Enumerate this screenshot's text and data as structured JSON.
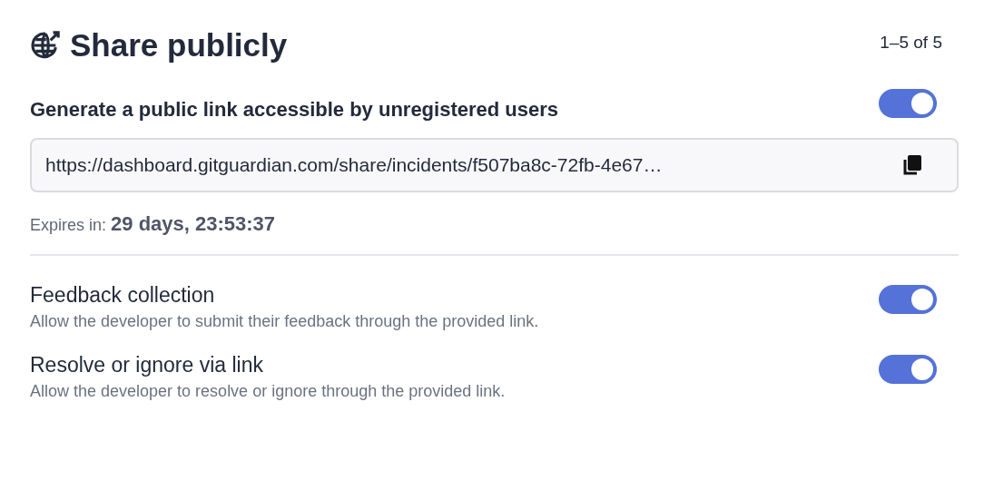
{
  "header": {
    "title": "Share publicly",
    "pagination": "1–5 of 5"
  },
  "public_link": {
    "label": "Generate a public link accessible by unregistered users",
    "on": true,
    "url": "https://dashboard.gitguardian.com/share/incidents/f507ba8c-72fb-4e67…",
    "expires": "Expires in: **29 days, 23:53:37**"
  },
  "settings": [
    {
      "title": "Feedback collection",
      "description": "Allow the developer to submit their feedback through the provided link.",
      "on": true
    },
    {
      "title": "Resolve or ignore via link",
      "description": "Allow the developer to resolve or ignore through the provided link.",
      "on": true
    }
  ]
}
